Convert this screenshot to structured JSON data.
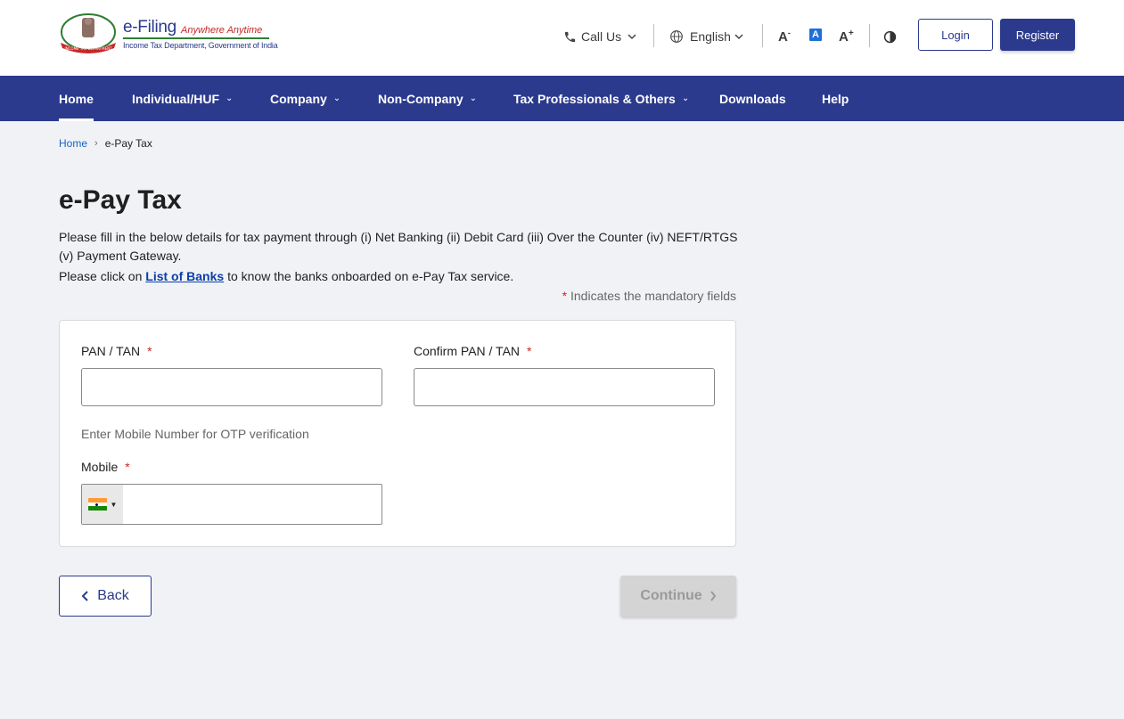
{
  "header": {
    "brand": "e-Filing",
    "tagline": "Anywhere Anytime",
    "department": "Income Tax Department, Government of India",
    "call_us": "Call Us",
    "language": "English",
    "font_decrease": "A",
    "font_default": "A",
    "font_increase": "A",
    "login_label": "Login",
    "register_label": "Register"
  },
  "nav": {
    "items": [
      {
        "label": "Home"
      },
      {
        "label": "Individual/HUF"
      },
      {
        "label": "Company"
      },
      {
        "label": "Non-Company"
      },
      {
        "label": "Tax Professionals & Others"
      },
      {
        "label": "Downloads"
      },
      {
        "label": "Help"
      }
    ]
  },
  "breadcrumb": {
    "home": "Home",
    "current": "e-Pay Tax"
  },
  "page": {
    "title": "e-Pay Tax",
    "description": "Please fill in the below details for tax payment through (i) Net Banking (ii) Debit Card (iii) Over the Counter (iv) NEFT/RTGS (v) Payment Gateway.",
    "click_prefix": "Please click on ",
    "link_label": "List of Banks",
    "click_suffix": " to know the banks onboarded on e-Pay Tax service.",
    "mandatory_star": "*",
    "mandatory_note": " Indicates the mandatory fields"
  },
  "form": {
    "pan_label": "PAN / TAN",
    "pan_value": "",
    "confirm_pan_label": "Confirm PAN / TAN",
    "confirm_pan_value": "",
    "mobile_hint": "Enter Mobile Number for OTP verification",
    "mobile_label": "Mobile",
    "mobile_value": "",
    "required_mark": "*"
  },
  "actions": {
    "back_label": "Back",
    "continue_label": "Continue"
  },
  "colors": {
    "primary": "#2b3a8c",
    "required": "#c62828",
    "link": "#0b3fa8",
    "disabled": "#d4d4d4"
  }
}
